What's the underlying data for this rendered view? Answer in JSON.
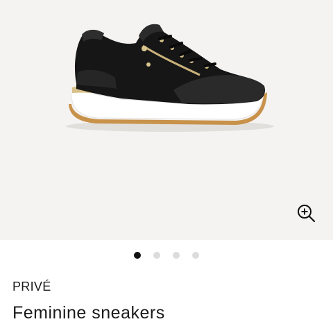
{
  "product": {
    "brand": "PRIVÉ",
    "name": "Feminine sneakers"
  },
  "gallery": {
    "image_count": 4,
    "active_index": 0,
    "zoom_icon": "zoom-in-icon"
  },
  "colors": {
    "gallery_bg": "#f4f3f2",
    "dot_active": "#111111",
    "dot_inactive": "#dcdcdc",
    "text": "#1a1a1a"
  }
}
